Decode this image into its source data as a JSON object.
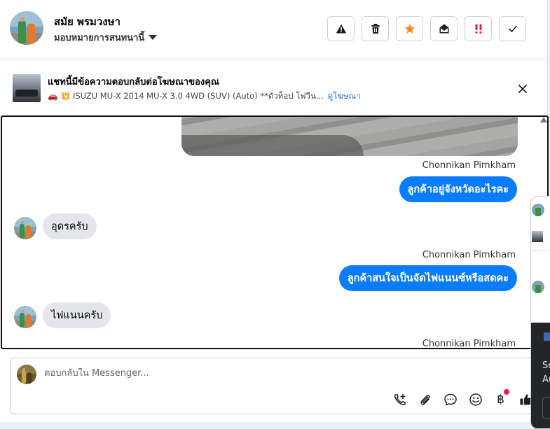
{
  "header": {
    "contact_name": "สมัย พรมวงษา",
    "assign_label": "มอบหมายการสนทนานี้",
    "tools": [
      {
        "icon": "warning-icon",
        "label": "spam"
      },
      {
        "icon": "trash-icon",
        "label": "delete"
      },
      {
        "icon": "star-icon",
        "label": "star"
      },
      {
        "icon": "mail-open-icon",
        "label": "mark unread"
      },
      {
        "icon": "follow-up-icon",
        "label": "follow up"
      },
      {
        "icon": "check-icon",
        "label": "done"
      }
    ]
  },
  "ad": {
    "title": "แชทนี้มีข้อความตอบกลับต่อโฆษณาของคุณ",
    "description": "🚗 💥 ISUZU MU-X 2014 MU-X 3.0 4WD (SUV) (Auto) **ตัวท็อป โฟวีน...",
    "link": "ดูโฆษณา"
  },
  "thread": {
    "messages": [
      {
        "type": "sender",
        "text": "Chonnikan Pimkham"
      },
      {
        "type": "outgoing",
        "text": "ลูกค้าอยู่จังหวัดอะไรคะ"
      },
      {
        "type": "incoming",
        "text": "อุดรครับ"
      },
      {
        "type": "sender",
        "text": "Chonnikan Pimkham"
      },
      {
        "type": "outgoing",
        "text": "ลูกค้าสนใจเป็นจัดไฟแนนซ์หรือสดคะ"
      },
      {
        "type": "incoming",
        "text": "ไฟแนนครับ"
      },
      {
        "type": "sender",
        "text": "Chonnikan Pimkham"
      }
    ]
  },
  "composer": {
    "placeholder": "ตอบกลับใน Messenger...",
    "value": "",
    "icons": [
      "call-add-icon",
      "attachment-icon",
      "saved-reply-icon",
      "emoji-icon",
      "payment-icon",
      "thumbs-up-icon"
    ],
    "payment_symbol": "฿"
  },
  "side_panel": {
    "text_line1": "So",
    "text_line2": "Au"
  },
  "colors": {
    "accent": "#0a7cff",
    "link": "#216fdb",
    "star": "#f08c1a",
    "alert_red": "#e41e3f"
  }
}
